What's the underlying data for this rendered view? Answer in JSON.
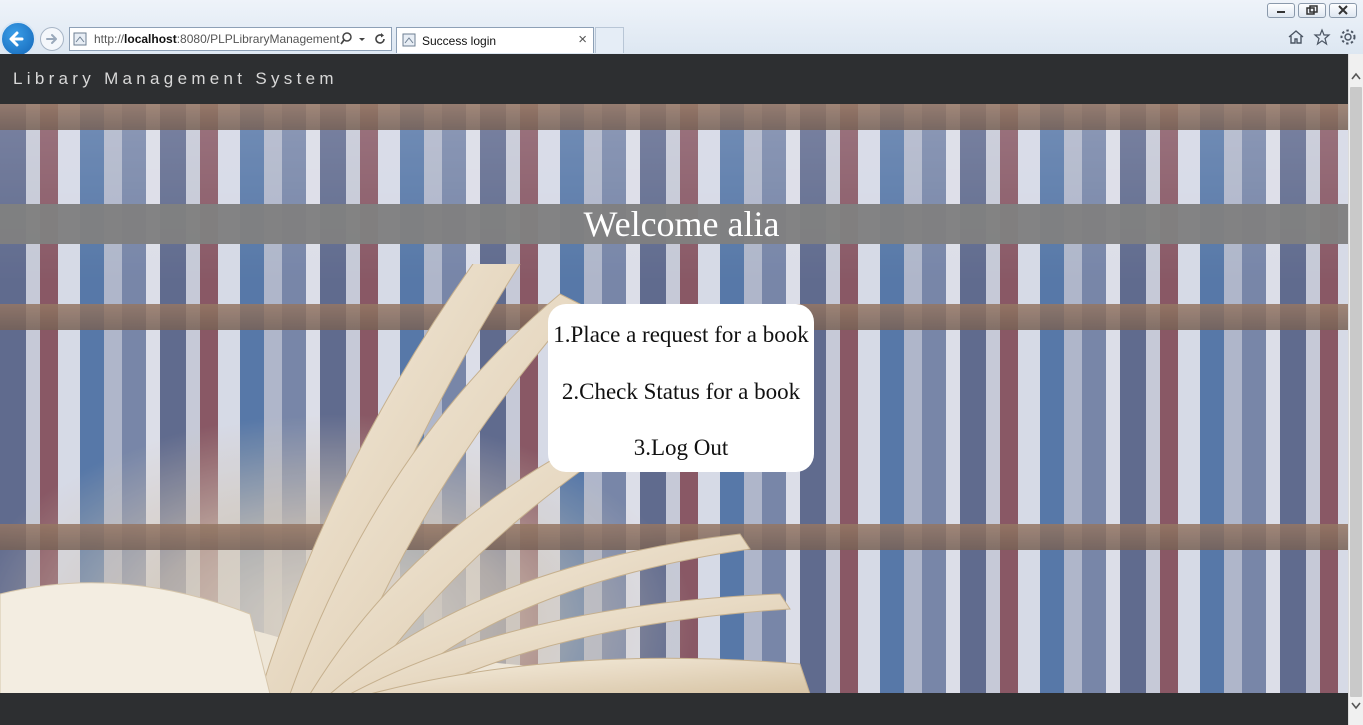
{
  "browser": {
    "url": {
      "prefix": "http://",
      "host": "localhost",
      "rest": ":8080/PLPLibraryManagement"
    },
    "tab_title": "Success login",
    "tab_close": "×",
    "icons": [
      "back-arrow-icon",
      "forward-arrow-icon",
      "search-icon",
      "dropdown-icon",
      "refresh-icon",
      "home-icon",
      "favorites-star-icon",
      "settings-gear-icon",
      "minimize-icon",
      "restore-icon",
      "close-icon"
    ]
  },
  "navbar": {
    "brand": "Library Management System",
    "background": "#2d2f31"
  },
  "page": {
    "welcome": "Welcome alia",
    "menu": [
      {
        "label": "1.Place a request for a book"
      },
      {
        "label": "2.Check Status for a book"
      },
      {
        "label": "3.Log Out"
      }
    ]
  }
}
